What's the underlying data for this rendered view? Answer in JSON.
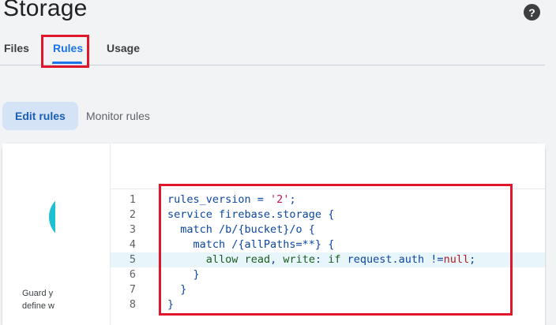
{
  "header": {
    "title": "Storage",
    "help_icon": "help-circle-icon",
    "help_glyph": "?"
  },
  "tabs": [
    {
      "label": "Files",
      "active": false
    },
    {
      "label": "Rules",
      "active": true
    },
    {
      "label": "Usage",
      "active": false
    }
  ],
  "rule_actions": {
    "edit_label": "Edit rules",
    "monitor_label": "Monitor rules"
  },
  "side_panel": {
    "text_line1": "Guard y",
    "text_line2": "define w"
  },
  "code_lines": [
    {
      "no": "1",
      "text": "rules_version = '2';"
    },
    {
      "no": "2",
      "text": "service firebase.storage {"
    },
    {
      "no": "3",
      "text": "  match /b/{bucket}/o {"
    },
    {
      "no": "4",
      "text": "    match /{allPaths=**} {"
    },
    {
      "no": "5",
      "text": "      allow read, write: if request.auth !=null;"
    },
    {
      "no": "6",
      "text": "    }"
    },
    {
      "no": "7",
      "text": "  }"
    },
    {
      "no": "8",
      "text": "}"
    }
  ],
  "colors": {
    "accent": "#1a73e8",
    "highlight_border": "#e0162b"
  }
}
